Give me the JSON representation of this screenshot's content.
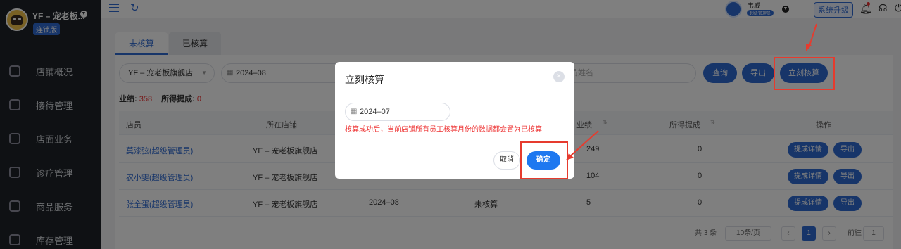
{
  "sidebar": {
    "shop_name": "YF – 宠老板...",
    "version_badge": "连锁版",
    "items": [
      {
        "label": "店铺概况",
        "icon": "dashboard-icon"
      },
      {
        "label": "接待管理",
        "icon": "reception-icon"
      },
      {
        "label": "店面业务",
        "icon": "store-icon"
      },
      {
        "label": "诊疗管理",
        "icon": "medical-icon"
      },
      {
        "label": "商品服务",
        "icon": "goods-icon"
      },
      {
        "label": "库存管理",
        "icon": "inventory-icon"
      }
    ]
  },
  "topbar": {
    "user_name": "韦威",
    "user_role": "超级管理员",
    "upgrade_label": "系统升级"
  },
  "tabs": {
    "active": "未核算",
    "inactive": "已核算"
  },
  "filters": {
    "shop_select": "YF – 宠老板旗舰店",
    "month_value": "2024–08",
    "name_placeholder": "员姓名"
  },
  "buttons": {
    "query": "查询",
    "export": "导出",
    "settle_now": "立刻核算"
  },
  "summary": {
    "perf_label": "业绩:",
    "perf_value": "358",
    "commission_label": "所得提成:",
    "commission_value": "0"
  },
  "table": {
    "headers": [
      "店员",
      "所在店铺",
      "业绩",
      "所得提成",
      "操作"
    ],
    "rows": [
      {
        "staff": "莫漆弦(超级管理员)",
        "shop": "YF – 宠老板旗舰店",
        "month": "",
        "status": "",
        "perf": "249",
        "commission": "0"
      },
      {
        "staff": "农小雯(超级管理员)",
        "shop": "YF – 宠老板旗舰店",
        "month": "",
        "status": "",
        "perf": "104",
        "commission": "0"
      },
      {
        "staff": "张全蛋(超级管理员)",
        "shop": "YF – 宠老板旗舰店",
        "month": "2024–08",
        "status": "未核算",
        "perf": "5",
        "commission": "0"
      }
    ],
    "detail_label": "提成详情",
    "export_label": "导出"
  },
  "pagination": {
    "total": "共 3 条",
    "page_size": "10条/页",
    "current_page": "1",
    "goto_label": "前往",
    "goto_value": "1"
  },
  "modal": {
    "title": "立刻核算",
    "close": "×",
    "date_value": "2024–07",
    "hint": "核算成功后，当前店铺所有员工核算月份的数据都会置为已核算",
    "cancel": "取消",
    "confirm": "确定"
  },
  "colors": {
    "primary": "#2f6bd3",
    "sidebar_bg": "#1e2329",
    "alert_red": "#e33",
    "annotation_red": "#e63b2e"
  }
}
